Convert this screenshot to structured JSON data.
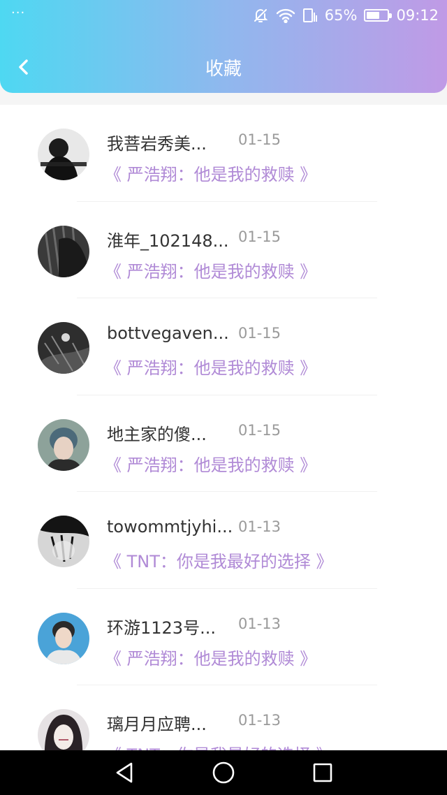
{
  "status_bar": {
    "dots": "···",
    "battery_percent": "65%",
    "battery_level": 0.65,
    "time": "09:12"
  },
  "header": {
    "title": "收藏"
  },
  "items": [
    {
      "username": "我菩岩秀美...",
      "date": "01-15",
      "topic": "《 严浩翔：他是我的救赎 》"
    },
    {
      "username": "淮年_102148...",
      "date": "01-15",
      "topic": "《 严浩翔：他是我的救赎 》"
    },
    {
      "username": "bottvegaven...",
      "date": "01-15",
      "topic": "《 严浩翔：他是我的救赎 》"
    },
    {
      "username": "地主家的傻...",
      "date": "01-15",
      "topic": "《 严浩翔：他是我的救赎 》"
    },
    {
      "username": "towommtjyhi...",
      "date": "01-13",
      "topic": "《 TNT：你是我最好的选择 》"
    },
    {
      "username": "环游1123号...",
      "date": "01-13",
      "topic": "《 严浩翔：他是我的救赎 》"
    },
    {
      "username": "璃月月应聘...",
      "date": "01-13",
      "topic": "《 TNT：你是我最好的选择 》"
    }
  ]
}
